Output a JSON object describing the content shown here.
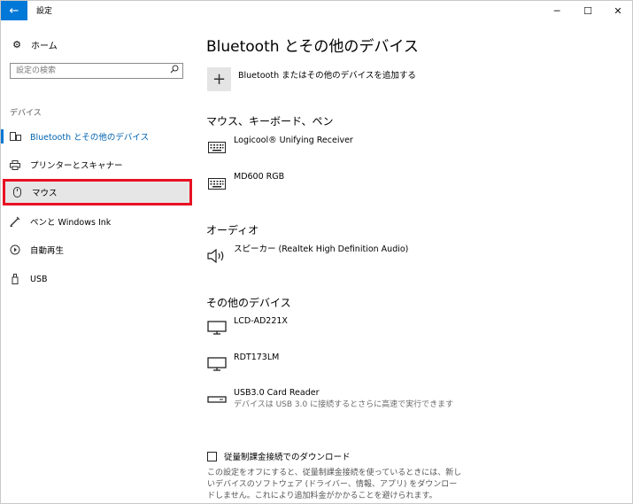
{
  "window": {
    "back_icon": "arrow-left-icon",
    "title": "設定",
    "controls": {
      "minimize": "─",
      "maximize": "☐",
      "close": "✕"
    }
  },
  "sidebar": {
    "home_label": "ホーム",
    "search_placeholder": "設定の検索",
    "section_label": "デバイス",
    "items": [
      {
        "label": "Bluetooth とその他のデバイス",
        "icon": "bluetooth-devices-icon",
        "active": true
      },
      {
        "label": "プリンターとスキャナー",
        "icon": "printer-icon"
      },
      {
        "label": "マウス",
        "icon": "mouse-icon",
        "highlighted": true
      },
      {
        "label": "ペンと Windows Ink",
        "icon": "pen-icon"
      },
      {
        "label": "自動再生",
        "icon": "autoplay-icon"
      },
      {
        "label": "USB",
        "icon": "usb-icon"
      }
    ]
  },
  "main": {
    "title": "Bluetooth とその他のデバイス",
    "add_device_label": "Bluetooth またはその他のデバイスを追加する",
    "groups": [
      {
        "title": "マウス、キーボード、ペン",
        "devices": [
          {
            "name": "Logicool® Unifying Receiver",
            "icon": "keyboard-icon"
          },
          {
            "name": "MD600 RGB",
            "icon": "keyboard-icon"
          }
        ]
      },
      {
        "title": "オーディオ",
        "devices": [
          {
            "name": "スピーカー (Realtek High Definition Audio)",
            "icon": "speaker-icon"
          }
        ]
      },
      {
        "title": "その他のデバイス",
        "devices": [
          {
            "name": "LCD-AD221X",
            "icon": "monitor-icon"
          },
          {
            "name": "RDT173LM",
            "icon": "monitor-icon"
          },
          {
            "name": "USB3.0 Card Reader",
            "icon": "card-reader-icon",
            "subtitle": "デバイスは USB 3.0 に接続するとさらに高速で実行できます"
          }
        ]
      }
    ],
    "metered": {
      "checked": false,
      "label": "従量制課金接続でのダウンロード",
      "description": "この設定をオフにすると、従量制課金接続を使っているときには、新しいデバイスのソフトウェア (ドライバー、情報、アプリ) をダウンロードしません。これにより追加料金がかかることを避けられます。"
    }
  },
  "colors": {
    "accent": "#0078d7",
    "active_text": "#0063b1",
    "highlight_border": "#e81123",
    "highlight_bg": "#e6e6e6"
  }
}
